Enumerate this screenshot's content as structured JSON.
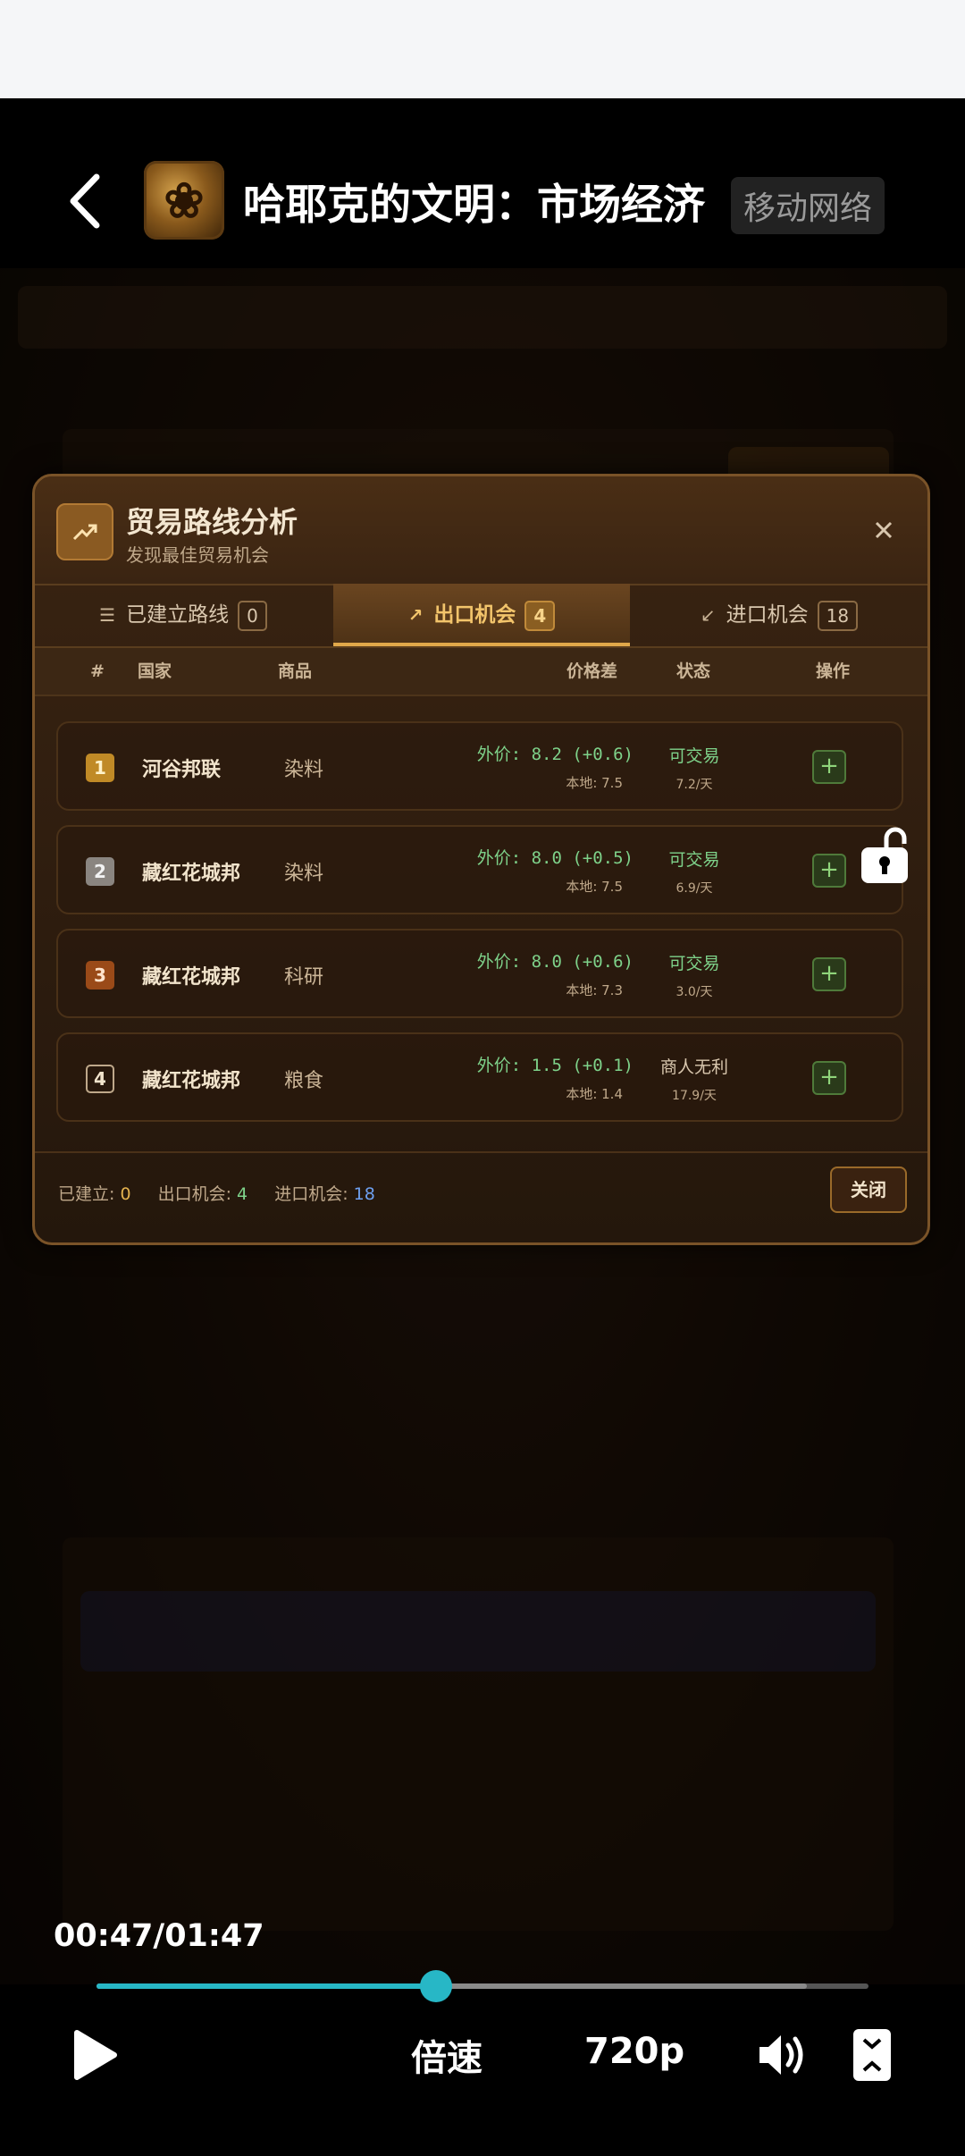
{
  "header": {
    "title": "哈耶克的文明：市场经济",
    "network_label": "移动网络"
  },
  "dialog": {
    "title": "贸易路线分析",
    "subtitle": "发现最佳贸易机会",
    "tabs": [
      {
        "label": "已建立路线",
        "count": "0",
        "icon": "list-icon"
      },
      {
        "label": "出口机会",
        "count": "4",
        "icon": "arrow-up-right-icon"
      },
      {
        "label": "进口机会",
        "count": "18",
        "icon": "arrow-down-left-icon"
      }
    ],
    "active_tab": 1,
    "columns": {
      "rank": "#",
      "country": "国家",
      "good": "商品",
      "price_diff": "价格差",
      "status": "状态",
      "action": "操作"
    },
    "rows": [
      {
        "rank": "1",
        "country": "河谷邦联",
        "good": "染料",
        "ext_price": "外价: 8.2 (+0.6)",
        "local_price": "本地: 7.5",
        "status": "可交易",
        "rate": "7.2/天"
      },
      {
        "rank": "2",
        "country": "藏红花城邦",
        "good": "染料",
        "ext_price": "外价: 8.0 (+0.5)",
        "local_price": "本地: 7.5",
        "status": "可交易",
        "rate": "6.9/天"
      },
      {
        "rank": "3",
        "country": "藏红花城邦",
        "good": "科研",
        "ext_price": "外价: 8.0 (+0.6)",
        "local_price": "本地: 7.3",
        "status": "可交易",
        "rate": "3.0/天"
      },
      {
        "rank": "4",
        "country": "藏红花城邦",
        "good": "粮食",
        "ext_price": "外价: 1.5 (+0.1)",
        "local_price": "本地: 1.4",
        "status": "商人无利",
        "rate": "17.9/天"
      }
    ],
    "footer": {
      "built_label": "已建立:",
      "built_value": "0",
      "export_label": "出口机会:",
      "export_value": "4",
      "import_label": "进口机会:",
      "import_value": "18",
      "close_label": "关闭"
    }
  },
  "player": {
    "time": "00:47/01:47",
    "progress": 0.44,
    "buffered": 0.92,
    "speed_label": "倍速",
    "quality_label": "720p"
  },
  "colors": {
    "accent": "#27b7c6",
    "gold": "#e0a84a",
    "green": "#7ed28a",
    "blue": "#6ea0f0"
  }
}
